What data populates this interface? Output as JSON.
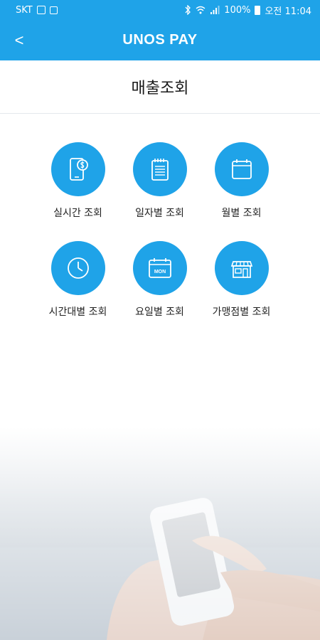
{
  "status_bar": {
    "carrier": "SKT",
    "battery": "100%",
    "time": "오전 11:04",
    "icons": [
      "image-icon",
      "sync-icon",
      "bluetooth-icon",
      "wifi-icon",
      "signal-icon",
      "battery-icon"
    ]
  },
  "app_bar": {
    "back_label": "<",
    "title": "UNOS PAY",
    "background": "#1fa3e8"
  },
  "page": {
    "title": "매출조회"
  },
  "menu": {
    "accent": "#1fa3e8",
    "items": [
      {
        "label": "실시간 조회",
        "icon": "phone-dollar-icon"
      },
      {
        "label": "일자별 조회",
        "icon": "notepad-icon"
      },
      {
        "label": "월별 조회",
        "icon": "calendar-icon"
      },
      {
        "label": "시간대별 조회",
        "icon": "clock-icon"
      },
      {
        "label": "요일별 조회",
        "icon": "calendar-mon-icon"
      },
      {
        "label": "가맹점별 조회",
        "icon": "storefront-icon"
      }
    ],
    "mon_text": "MON"
  }
}
